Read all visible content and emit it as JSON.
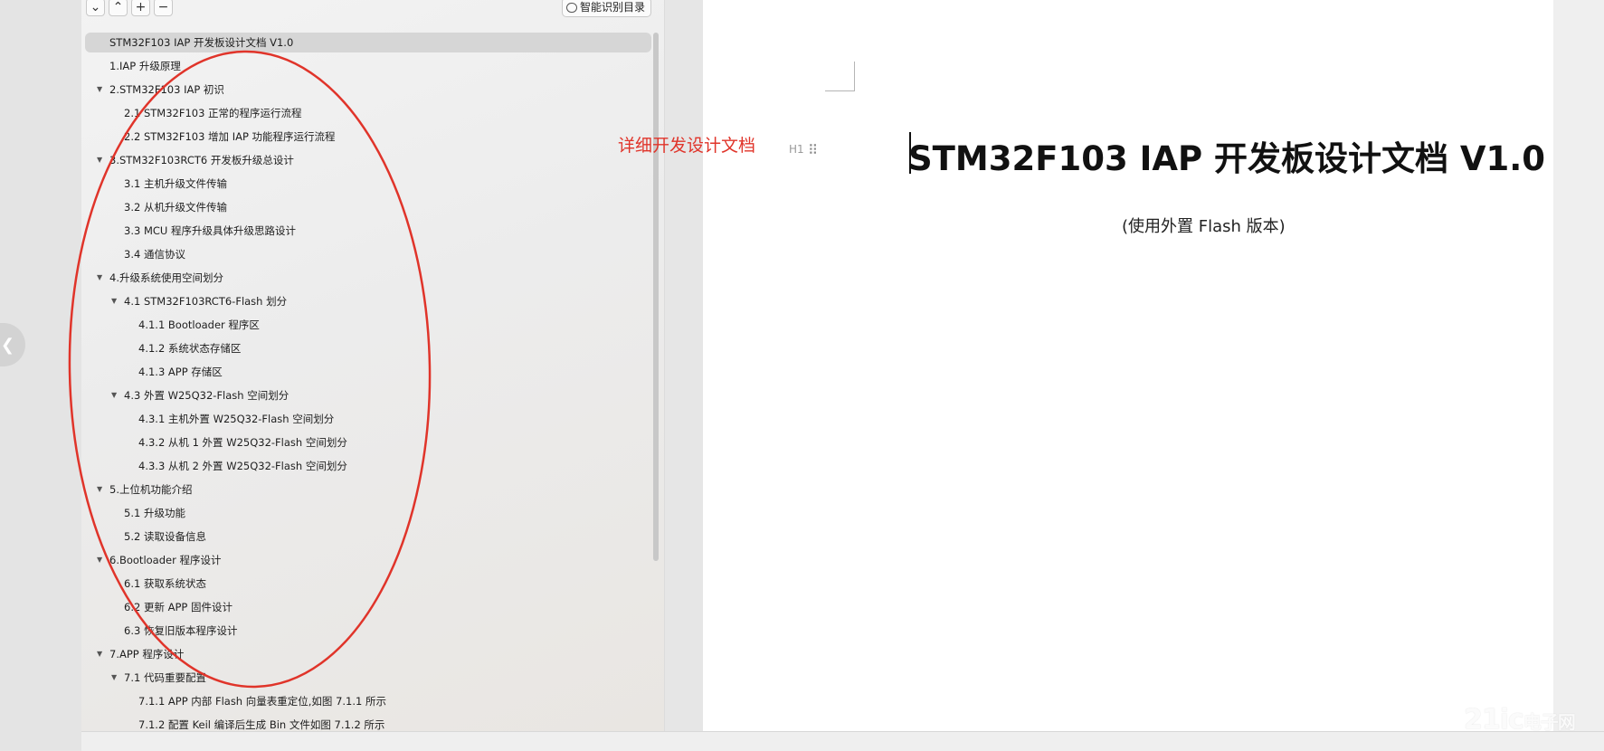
{
  "toolbar": {
    "buttons": [
      "⌄",
      "⌃",
      "+",
      "−"
    ],
    "smart_toc_label": "智能识别目录"
  },
  "toc": [
    {
      "label": "STM32F103 IAP 开发板设计文档 V1.0",
      "level": 0,
      "expanded": null,
      "selected": true
    },
    {
      "label": "1.IAP 升级原理",
      "level": 0,
      "expanded": null
    },
    {
      "label": "2.STM32F103 IAP 初识",
      "level": 0,
      "expanded": true
    },
    {
      "label": "2.1 STM32F103 正常的程序运行流程",
      "level": 1,
      "expanded": null
    },
    {
      "label": "2.2 STM32F103 增加 IAP 功能程序运行流程",
      "level": 1,
      "expanded": null
    },
    {
      "label": "3.STM32F103RCT6 开发板升级总设计",
      "level": 0,
      "expanded": true
    },
    {
      "label": "3.1 主机升级文件传输",
      "level": 1,
      "expanded": null
    },
    {
      "label": "3.2 从机升级文件传输",
      "level": 1,
      "expanded": null
    },
    {
      "label": "3.3 MCU 程序升级具体升级思路设计",
      "level": 1,
      "expanded": null
    },
    {
      "label": "3.4 通信协议",
      "level": 1,
      "expanded": null
    },
    {
      "label": "4.升级系统使用空间划分",
      "level": 0,
      "expanded": true
    },
    {
      "label": "4.1 STM32F103RCT6-Flash 划分",
      "level": 1,
      "expanded": true
    },
    {
      "label": "4.1.1 Bootloader  程序区",
      "level": 2,
      "expanded": null
    },
    {
      "label": "4.1.2 系统状态存储区",
      "level": 2,
      "expanded": null
    },
    {
      "label": "4.1.3 APP 存储区",
      "level": 2,
      "expanded": null
    },
    {
      "label": "4.3 外置 W25Q32-Flash 空间划分",
      "level": 1,
      "expanded": true
    },
    {
      "label": "4.3.1 主机外置 W25Q32-Flash 空间划分",
      "level": 2,
      "expanded": null
    },
    {
      "label": "4.3.2 从机 1 外置 W25Q32-Flash 空间划分",
      "level": 2,
      "expanded": null
    },
    {
      "label": "4.3.3 从机 2 外置 W25Q32-Flash 空间划分",
      "level": 2,
      "expanded": null
    },
    {
      "label": "5.上位机功能介绍",
      "level": 0,
      "expanded": true
    },
    {
      "label": "5.1 升级功能",
      "level": 1,
      "expanded": null
    },
    {
      "label": "5.2 读取设备信息",
      "level": 1,
      "expanded": null
    },
    {
      "label": "6.Bootloader 程序设计",
      "level": 0,
      "expanded": true
    },
    {
      "label": "6.1 获取系统状态",
      "level": 1,
      "expanded": null
    },
    {
      "label": "6.2 更新 APP 固件设计",
      "level": 1,
      "expanded": null
    },
    {
      "label": "6.3 恢复旧版本程序设计",
      "level": 1,
      "expanded": null
    },
    {
      "label": "7.APP 程序设计",
      "level": 0,
      "expanded": true
    },
    {
      "label": "7.1  代码重要配置",
      "level": 1,
      "expanded": true
    },
    {
      "label": "7.1.1    APP 内部  Flash  向量表重定位,如图 7.1.1 所示",
      "level": 2,
      "expanded": null
    },
    {
      "label": "7.1.2  配置 Keil 编译后生成 Bin 文件如图 7.1.2 所示",
      "level": 2,
      "expanded": null
    }
  ],
  "annotation": "详细开发设计文档",
  "heading_tag": "H1",
  "document": {
    "title": "STM32F103 IAP 开发板设计文档 V1.0",
    "subtitle": "(使用外置 Flash 版本)"
  },
  "watermark": {
    "brand": "21ic",
    "cn": "电子网"
  },
  "colors": {
    "annotation_red": "#e0342a",
    "selected_row": "#d6d6d6",
    "panel_bg": "#efefef"
  },
  "icons": [
    "chevron-left-icon",
    "expand-down-icon",
    "collapse-up-icon",
    "plus-icon",
    "minus-icon",
    "smart-toc-icon",
    "drag-handle-icon",
    "heading-icon",
    "caret-down-icon"
  ]
}
